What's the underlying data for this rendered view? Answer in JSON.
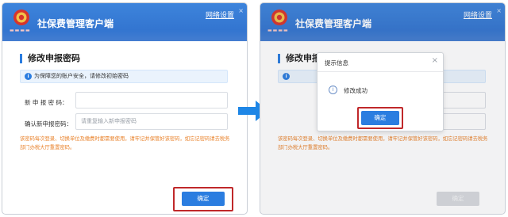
{
  "app": {
    "title": "社保费管理客户端",
    "network_settings": "网络设置",
    "close_glyph": "×"
  },
  "form": {
    "section_title": "修改申报密码",
    "info_text": "为保障您的账户安全，请修改初始密码",
    "new_password_label": "新 申 报 密 码：",
    "confirm_password_label": "确认新申报密码：",
    "confirm_password_placeholder": "请重复输入新申报密码",
    "notice": "该密码每次登录、切换单位及缴费时都需要使用，请牢记并保管好该密码。如忘记密码请去税务部门办税大厅重置密码。",
    "notice_truncated": "该密码每次登录、切换单位及缴费时都需要使用，请牢记并保管好该密码，如忘记密码请去税务部门办税大厅重置密码。",
    "confirm_button": "确定"
  },
  "dialog": {
    "title": "提示信息",
    "message": "修改成功",
    "confirm_button": "确定",
    "info_glyph": "i"
  },
  "colors": {
    "header_blue": "#3d84dc",
    "primary_button": "#2b7de0",
    "highlight_red": "#c0282a",
    "notice_orange": "#e9822b",
    "arrow_blue": "#1e86e6"
  },
  "icons": {
    "emblem": "tax-emblem-icon",
    "info": "info-icon",
    "arrow": "right-arrow-icon"
  }
}
